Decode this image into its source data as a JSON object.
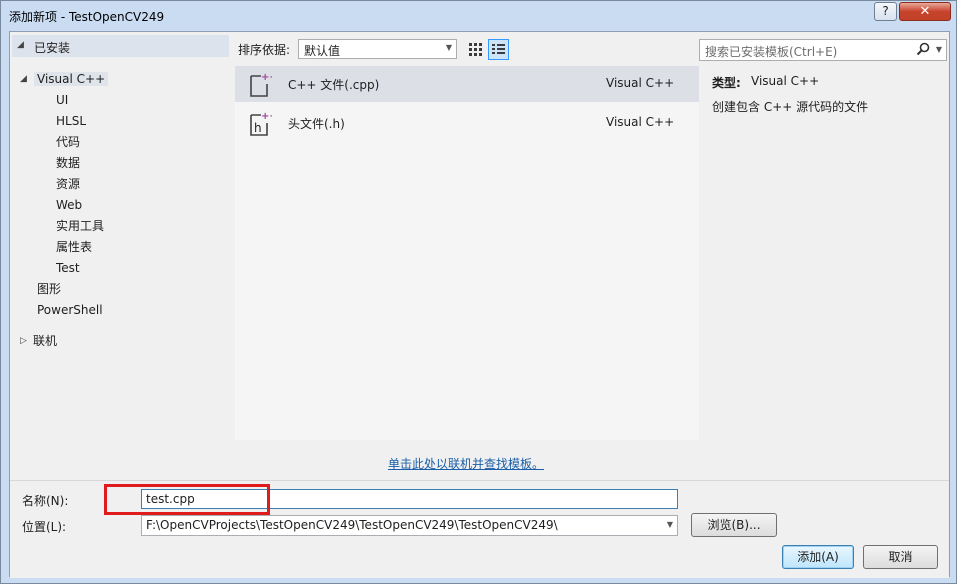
{
  "window": {
    "title": "添加新项 - TestOpenCV249",
    "help_label": "?",
    "close_label": "✕"
  },
  "sidebar": {
    "installed_label": "已安装",
    "visual_cpp_label": "Visual C++",
    "sub_items": [
      "UI",
      "HLSL",
      "代码",
      "数据",
      "资源",
      "Web",
      "实用工具",
      "属性表",
      "Test"
    ],
    "graphics_label": "图形",
    "powershell_label": "PowerShell",
    "online_label": "联机"
  },
  "toolbar": {
    "sort_label": "排序依据:",
    "sort_value": "默认值",
    "search_placeholder": "搜索已安装模板(Ctrl+E)"
  },
  "templates": [
    {
      "name": "C++ 文件(.cpp)",
      "language": "Visual C++",
      "icon": "cpp-file-icon",
      "selected": true
    },
    {
      "name": "头文件(.h)",
      "language": "Visual C++",
      "icon": "header-file-icon",
      "selected": false
    }
  ],
  "description": {
    "type_label": "类型:",
    "type_value": "Visual C++",
    "text": "创建包含 C++ 源代码的文件"
  },
  "online_link": "单击此处以联机并查找模板。",
  "form": {
    "name_label": "名称(N):",
    "name_value": "test.cpp",
    "location_label": "位置(L):",
    "location_value": "F:\\OpenCVProjects\\TestOpenCV249\\TestOpenCV249\\TestOpenCV249\\",
    "browse_label": "浏览(B)...",
    "add_label": "添加(A)",
    "cancel_label": "取消"
  },
  "colors": {
    "highlight_border": "#e01b1b",
    "link": "#1a5ea8",
    "selection": "#dcdfe6"
  }
}
